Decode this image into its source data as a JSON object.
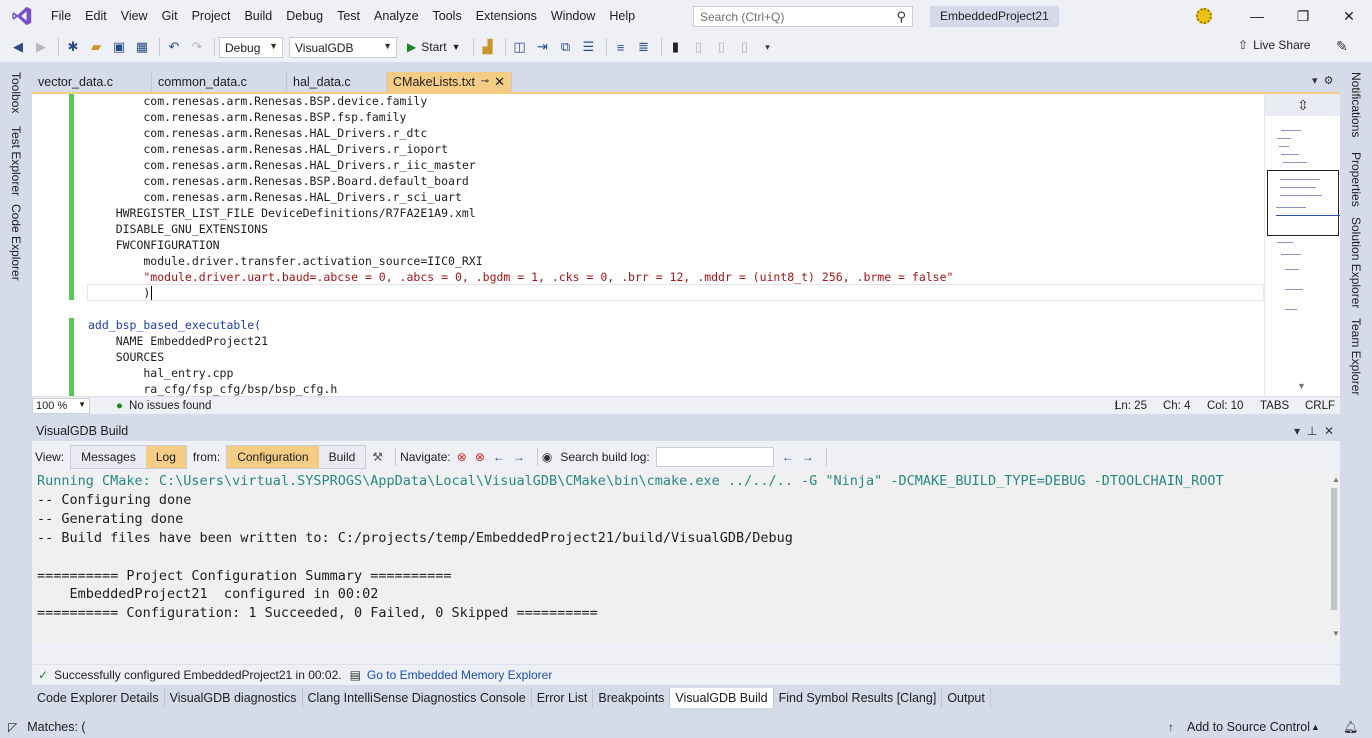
{
  "menu": {
    "items": [
      "File",
      "Edit",
      "View",
      "Git",
      "Project",
      "Build",
      "Debug",
      "Test",
      "Analyze",
      "Tools",
      "Extensions",
      "Window",
      "Help"
    ],
    "search_placeholder": "Search (Ctrl+Q)",
    "solution_name": "EmbeddedProject21"
  },
  "toolbar": {
    "config": "Debug",
    "platform": "VisualGDB",
    "start_label": "Start",
    "live_share_label": "Live Share"
  },
  "side_tabs": {
    "left": [
      "Toolbox",
      "Test Explorer",
      "Code Explorer"
    ],
    "right": [
      "Notifications",
      "Properties",
      "Solution Explorer",
      "Team Explorer"
    ]
  },
  "doc_tabs": [
    {
      "label": "vector_data.c",
      "active": false
    },
    {
      "label": "common_data.c",
      "active": false
    },
    {
      "label": "hal_data.c",
      "active": false
    },
    {
      "label": "CMakeLists.txt",
      "active": true
    }
  ],
  "editor": {
    "lines": [
      "        com.renesas.arm.Renesas.BSP.device.family",
      "        com.renesas.arm.Renesas.BSP.fsp.family",
      "        com.renesas.arm.Renesas.HAL_Drivers.r_dtc",
      "        com.renesas.arm.Renesas.HAL_Drivers.r_ioport",
      "        com.renesas.arm.Renesas.HAL_Drivers.r_iic_master",
      "        com.renesas.arm.Renesas.BSP.Board.default_board",
      "        com.renesas.arm.Renesas.HAL_Drivers.r_sci_uart",
      "    HWREGISTER_LIST_FILE DeviceDefinitions/R7FA2E1A9.xml",
      "    DISABLE_GNU_EXTENSIONS",
      "    FWCONFIGURATION",
      "        module.driver.transfer.activation_source=IIC0_RXI",
      "        \"module.driver.uart.baud=.abcse = 0, .abcs = 0, .bgdm = 1, .cks = 0, .brr = 12, .mddr = (uint8_t) 256, .brme = false\"",
      "        )",
      "",
      "add_bsp_based_executable(",
      "    NAME EmbeddedProject21",
      "    SOURCES",
      "        hal_entry.cpp",
      "        ra_cfg/fsp_cfg/bsp/bsp_cfg.h"
    ],
    "status": {
      "zoom": "100 %",
      "issues": "No issues found",
      "ln": "Ln: 25",
      "ch": "Ch: 4",
      "col": "Col: 10",
      "tabs": "TABS",
      "eol": "CRLF"
    }
  },
  "build_pane": {
    "title": "VisualGDB Build",
    "view_label": "View:",
    "view_messages": "Messages",
    "view_log": "Log",
    "from_label": "from:",
    "from_configuration": "Configuration",
    "from_build": "Build",
    "navigate_label": "Navigate:",
    "search_label": "Search build log:",
    "log_lines": [
      "Running CMake: C:\\Users\\virtual.SYSPROGS\\AppData\\Local\\VisualGDB\\CMake\\bin\\cmake.exe ../../.. -G \"Ninja\" -DCMAKE_BUILD_TYPE=DEBUG -DTOOLCHAIN_ROOT",
      "-- Configuring done",
      "-- Generating done",
      "-- Build files have been written to: C:/projects/temp/EmbeddedProject21/build/VisualGDB/Debug",
      "",
      "========== Project Configuration Summary ==========",
      "    EmbeddedProject21  configured in 00:02",
      "========== Configuration: 1 Succeeded, 0 Failed, 0 Skipped =========="
    ],
    "status_text": "Successfully configured EmbeddedProject21 in 00:02.",
    "memory_link": "Go to Embedded Memory Explorer"
  },
  "bottom_tabs": [
    {
      "label": "Code Explorer Details",
      "active": false
    },
    {
      "label": "VisualGDB diagnostics",
      "active": false
    },
    {
      "label": "Clang IntelliSense Diagnostics Console",
      "active": false
    },
    {
      "label": "Error List",
      "active": false
    },
    {
      "label": "Breakpoints",
      "active": false
    },
    {
      "label": "VisualGDB Build",
      "active": true
    },
    {
      "label": "Find Symbol Results [Clang]",
      "active": false
    },
    {
      "label": "Output",
      "active": false
    }
  ],
  "statusbar": {
    "matches": "Matches: (",
    "source_control": "Add to Source Control"
  },
  "colors": {
    "accent_tab": "#f5cc84",
    "change_bar": "#57c755",
    "log_command": "#27897f"
  }
}
